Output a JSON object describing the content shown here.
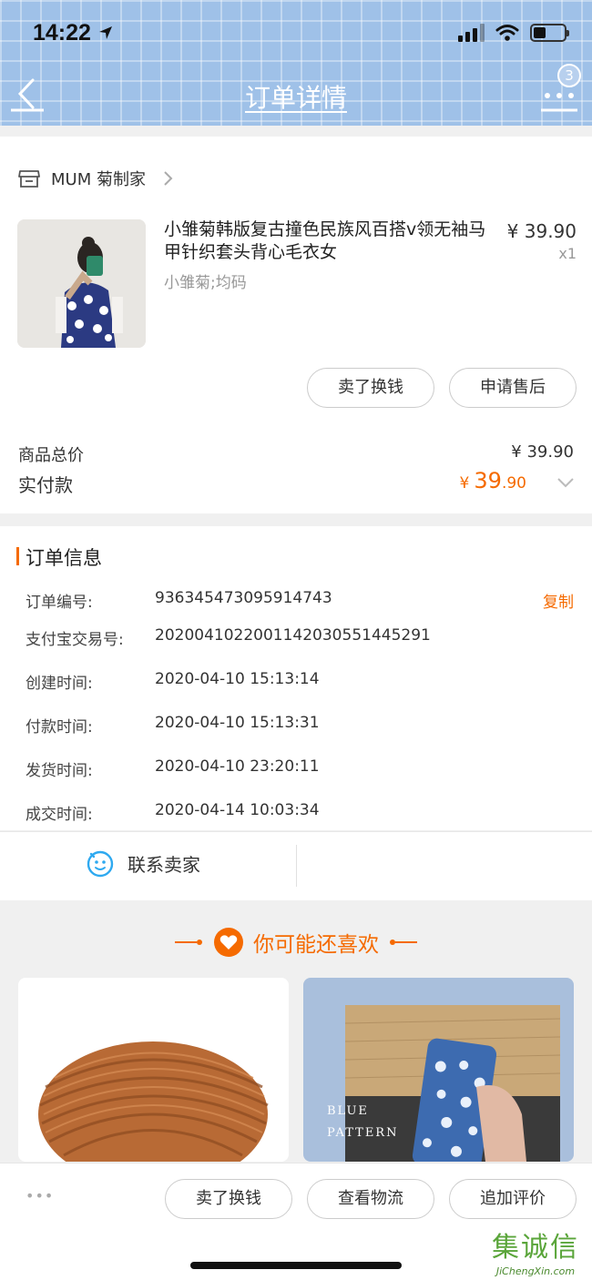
{
  "status_bar": {
    "time": "14:22"
  },
  "header": {
    "title": "订单详情",
    "badge": "3"
  },
  "shop": {
    "name": "MUM 菊制家"
  },
  "product": {
    "title": "小雏菊韩版复古撞色民族风百搭v领无袖马甲针织套头背心毛衣女",
    "sku": "小雏菊;均码",
    "price": "¥ 39.90",
    "qty": "x1",
    "actions": [
      "卖了换钱",
      "申请售后"
    ]
  },
  "summary": {
    "total_label": "商品总价",
    "total_value": "¥ 39.90",
    "paid_label": "实付款",
    "paid_currency": "¥",
    "paid_int": "39",
    "paid_dec": ".90"
  },
  "order_info": {
    "title": "订单信息",
    "copy_label": "复制",
    "rows": [
      {
        "label": "订单编号:",
        "value": "936345473095914743"
      },
      {
        "label": "支付宝交易号:",
        "value": "2020041022001142030551445291"
      },
      {
        "label": "创建时间:",
        "value": "2020-04-10 15:13:14"
      },
      {
        "label": "付款时间:",
        "value": "2020-04-10 15:13:31"
      },
      {
        "label": "发货时间:",
        "value": "2020-04-10 23:20:11"
      },
      {
        "label": "成交时间:",
        "value": "2020-04-14 10:03:34"
      }
    ]
  },
  "contact": {
    "label": "联系卖家"
  },
  "recommend": {
    "title": "你可能还喜欢",
    "card2_text_1": "BLUE",
    "card2_text_2": "PATTERN"
  },
  "bottom_bar": {
    "more": "•••",
    "buttons": [
      "卖了换钱",
      "查看物流",
      "追加评价"
    ]
  },
  "watermark": {
    "logo_text": "集诚信",
    "url": "JiChengXin.com"
  },
  "colors": {
    "accent": "#f56a00",
    "header_bg": "#9fc1e8",
    "contact_icon": "#2ea9f0"
  },
  "icons": [
    "back-arrow-icon",
    "more-dots-icon",
    "shop-icon",
    "chevron-right-icon",
    "chevron-down-icon",
    "smile-chat-icon",
    "heart-icon",
    "signal-icon",
    "wifi-icon",
    "battery-icon",
    "location-arrow-icon"
  ]
}
